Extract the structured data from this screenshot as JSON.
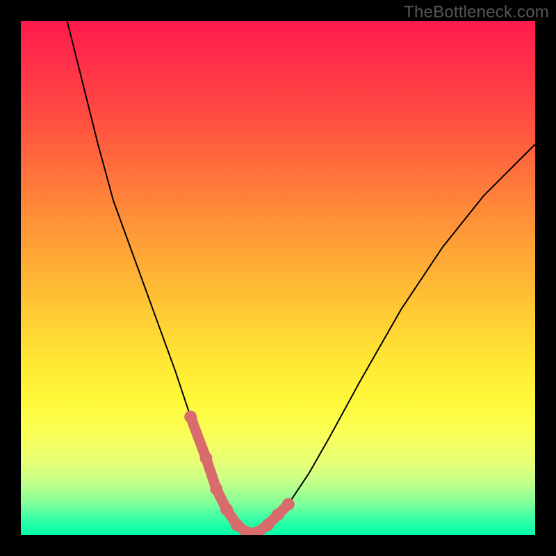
{
  "watermark": "TheBottleneck.com",
  "chart_data": {
    "type": "line",
    "title": "",
    "xlabel": "",
    "ylabel": "",
    "xlim": [
      0,
      100
    ],
    "ylim": [
      0,
      100
    ],
    "grid": false,
    "series": [
      {
        "name": "bottleneck-curve",
        "x": [
          9,
          12,
          15,
          18,
          22,
          26,
          30,
          33,
          36,
          38,
          40,
          42,
          44,
          46,
          48,
          52,
          56,
          60,
          66,
          74,
          82,
          90,
          100
        ],
        "values": [
          100,
          88,
          76,
          65,
          54,
          43,
          32,
          23,
          15,
          9,
          5,
          2,
          0.5,
          0.5,
          2,
          6,
          12,
          19,
          30,
          44,
          56,
          66,
          76
        ]
      }
    ],
    "annotations": {
      "highlight_segment": {
        "color": "#d86b6b",
        "x": [
          33,
          36,
          38,
          40,
          42,
          44,
          46,
          48,
          50,
          52
        ],
        "values": [
          23,
          15,
          9,
          5,
          2,
          0.5,
          0.5,
          2,
          4,
          6
        ]
      }
    }
  }
}
